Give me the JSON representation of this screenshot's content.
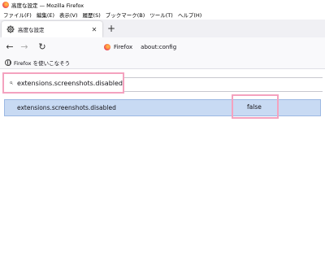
{
  "window": {
    "title": "高度な設定 — Mozilla Firefox"
  },
  "menubar": {
    "items": [
      "ファイル(F)",
      "編集(E)",
      "表示(V)",
      "履歴(S)",
      "ブックマーク(B)",
      "ツール(T)",
      "ヘルプ(H)"
    ]
  },
  "tabs": [
    {
      "label": "高度な設定",
      "icon": "gear-icon"
    }
  ],
  "toolbar": {
    "new_tab_label": "+",
    "back_label": "←",
    "forward_label": "→",
    "reload_label": "↻"
  },
  "urlbar": {
    "identity_label": "Firefox",
    "url": "about:config"
  },
  "bookmarks": {
    "items": [
      {
        "label": "Firefox を使いこなそう",
        "icon": "globe-icon"
      }
    ]
  },
  "search": {
    "value": "extensions.screenshots.disabled"
  },
  "preferences": [
    {
      "name": "extensions.screenshots.disabled",
      "value": "false"
    }
  ],
  "colors": {
    "highlight_border": "#f4a2bf",
    "selected_row": "#c8daf3"
  }
}
